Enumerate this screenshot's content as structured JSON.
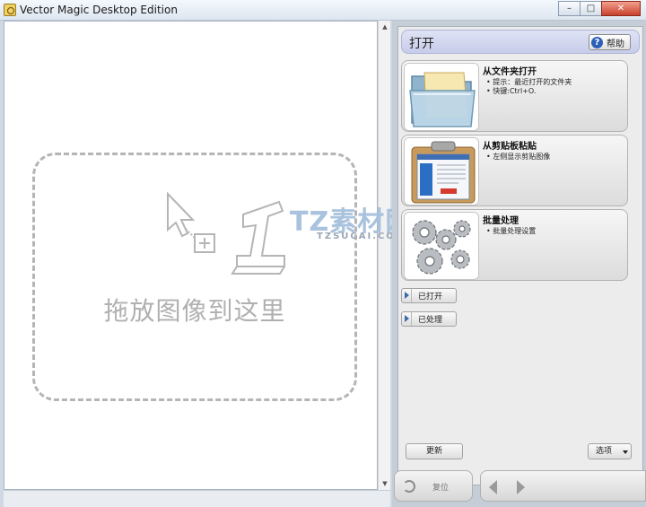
{
  "window": {
    "title": "Vector Magic Desktop Edition",
    "minimize_icon": "minimize-icon",
    "maximize_icon": "maximize-icon",
    "close_icon": "close-icon"
  },
  "canvas": {
    "drop_text": "拖放图像到这里"
  },
  "panel": {
    "title": "打开",
    "help_label": "帮助",
    "cards": [
      {
        "title": "从文件夹打开",
        "bullets": [
          "提示：最近打开的文件夹",
          "快键:Ctrl+O."
        ],
        "thumb_icon": "folder-icon"
      },
      {
        "title": "从剪贴板粘贴",
        "bullets": [
          "左侧显示剪贴图像"
        ],
        "thumb_icon": "clipboard-icon"
      },
      {
        "title": "批量处理",
        "bullets": [
          "批量处理设置"
        ],
        "thumb_icon": "gears-icon"
      }
    ],
    "opened_label": "已打开",
    "processed_label": "已处理",
    "update_label": "更新",
    "options_label": "选项",
    "reset_label": "复位"
  },
  "watermark": {
    "main": "TZ素材网",
    "sub": "TZSUCAI.COM"
  },
  "colors": {
    "header_bg": "#c7cdea",
    "panel_bg": "#ececec",
    "accent": "#2c5fb8"
  }
}
